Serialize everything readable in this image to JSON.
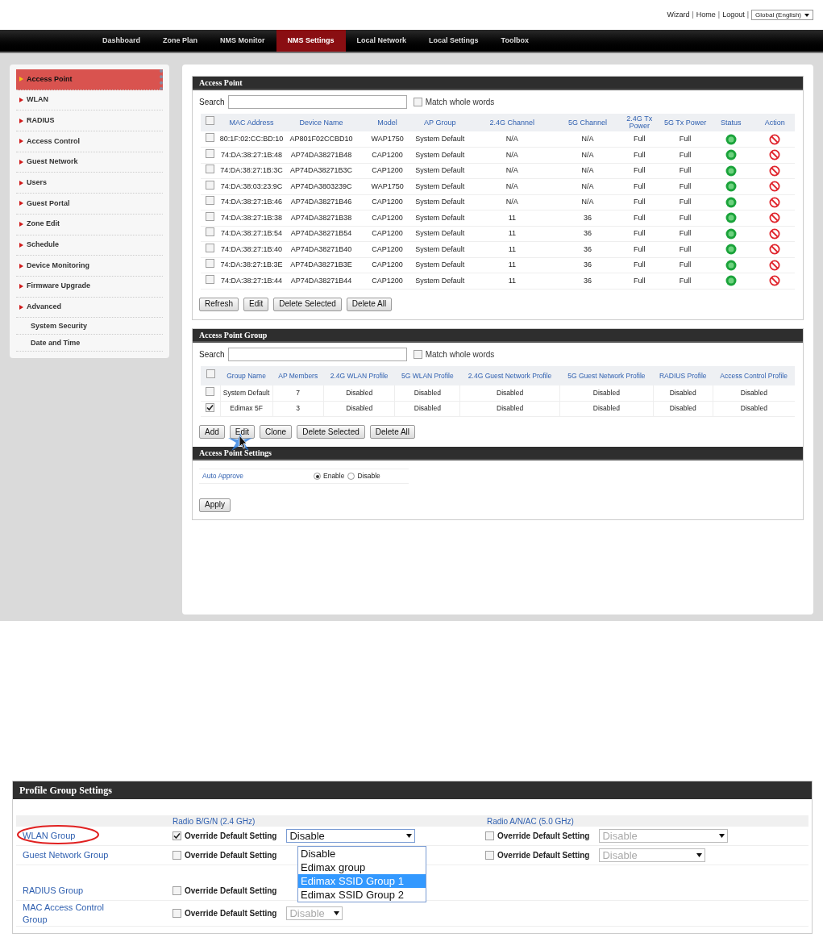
{
  "top_links": [
    "Wizard",
    "Home",
    "Logout"
  ],
  "link_separator": "|",
  "language_select": "Global (English)",
  "nav": [
    {
      "label": "Dashboard",
      "selected": false
    },
    {
      "label": "Zone Plan",
      "selected": false
    },
    {
      "label": "NMS Monitor",
      "selected": false
    },
    {
      "label": "NMS Settings",
      "selected": true
    },
    {
      "label": "Local Network",
      "selected": false
    },
    {
      "label": "Local Settings",
      "selected": false
    },
    {
      "label": "Toolbox",
      "selected": false
    }
  ],
  "sidebar": [
    {
      "label": "Access Point",
      "kind": "item",
      "selected": true
    },
    {
      "label": "WLAN",
      "kind": "item",
      "selected": false
    },
    {
      "label": "RADIUS",
      "kind": "item",
      "selected": false
    },
    {
      "label": "Access Control",
      "kind": "item",
      "selected": false
    },
    {
      "label": "Guest Network",
      "kind": "item",
      "selected": false
    },
    {
      "label": "Users",
      "kind": "item",
      "selected": false
    },
    {
      "label": "Guest Portal",
      "kind": "item",
      "selected": false
    },
    {
      "label": "Zone Edit",
      "kind": "item",
      "selected": false
    },
    {
      "label": "Schedule",
      "kind": "item",
      "selected": false
    },
    {
      "label": "Device Monitoring",
      "kind": "item",
      "selected": false
    },
    {
      "label": "Firmware Upgrade",
      "kind": "item",
      "selected": false
    },
    {
      "label": "Advanced",
      "kind": "item",
      "selected": false
    },
    {
      "label": "System Security",
      "kind": "subitem",
      "selected": false
    },
    {
      "label": "Date and Time",
      "kind": "subitem",
      "selected": false
    }
  ],
  "access_point": {
    "title": "Access Point",
    "search_label": "Search",
    "match_label": "Match whole words",
    "match_checked": false,
    "select_all_checked": false,
    "columns": [
      "MAC Address",
      "Device Name",
      "Model",
      "AP Group",
      "2.4G Channel",
      "5G Channel",
      "2.4G Tx Power",
      "5G Tx Power",
      "Status",
      "Action"
    ],
    "rows": [
      {
        "checked": false,
        "cells": [
          "80:1F:02:CC:BD:10",
          "AP801F02CCBD10",
          "WAP1750",
          "System Default",
          "N/A",
          "N/A",
          "Full",
          "Full"
        ],
        "online": true
      },
      {
        "checked": false,
        "cells": [
          "74:DA:38:27:1B:48",
          "AP74DA38271B48",
          "CAP1200",
          "System Default",
          "N/A",
          "N/A",
          "Full",
          "Full"
        ],
        "online": true
      },
      {
        "checked": false,
        "cells": [
          "74:DA:38:27:1B:3C",
          "AP74DA38271B3C",
          "CAP1200",
          "System Default",
          "N/A",
          "N/A",
          "Full",
          "Full"
        ],
        "online": true
      },
      {
        "checked": false,
        "cells": [
          "74:DA:38:03:23:9C",
          "AP74DA3803239C",
          "WAP1750",
          "System Default",
          "N/A",
          "N/A",
          "Full",
          "Full"
        ],
        "online": true
      },
      {
        "checked": false,
        "cells": [
          "74:DA:38:27:1B:46",
          "AP74DA38271B46",
          "CAP1200",
          "System Default",
          "N/A",
          "N/A",
          "Full",
          "Full"
        ],
        "online": true
      },
      {
        "checked": false,
        "cells": [
          "74:DA:38:27:1B:38",
          "AP74DA38271B38",
          "CAP1200",
          "System Default",
          "11",
          "36",
          "Full",
          "Full"
        ],
        "online": true
      },
      {
        "checked": false,
        "cells": [
          "74:DA:38:27:1B:54",
          "AP74DA38271B54",
          "CAP1200",
          "System Default",
          "11",
          "36",
          "Full",
          "Full"
        ],
        "online": true
      },
      {
        "checked": false,
        "cells": [
          "74:DA:38:27:1B:40",
          "AP74DA38271B40",
          "CAP1200",
          "System Default",
          "11",
          "36",
          "Full",
          "Full"
        ],
        "online": true
      },
      {
        "checked": false,
        "cells": [
          "74:DA:38:27:1B:3E",
          "AP74DA38271B3E",
          "CAP1200",
          "System Default",
          "11",
          "36",
          "Full",
          "Full"
        ],
        "online": true
      },
      {
        "checked": false,
        "cells": [
          "74:DA:38:27:1B:44",
          "AP74DA38271B44",
          "CAP1200",
          "System Default",
          "11",
          "36",
          "Full",
          "Full"
        ],
        "online": true
      }
    ],
    "buttons": [
      "Refresh",
      "Edit",
      "Delete Selected",
      "Delete All"
    ]
  },
  "ap_group": {
    "title": "Access Point Group",
    "search_label": "Search",
    "match_label": "Match whole words",
    "match_checked": false,
    "select_all_checked": false,
    "columns": [
      "Group Name",
      "AP Members",
      "2.4G WLAN Profile",
      "5G WLAN Profile",
      "2.4G Guest Network Profile",
      "5G Guest Network Profile",
      "RADIUS Profile",
      "Access Control Profile"
    ],
    "rows": [
      {
        "checked": false,
        "cells": [
          "System Default",
          "7",
          "Disabled",
          "Disabled",
          "Disabled",
          "Disabled",
          "Disabled",
          "Disabled"
        ]
      },
      {
        "checked": true,
        "cells": [
          "Edimax 5F",
          "3",
          "Disabled",
          "Disabled",
          "Disabled",
          "Disabled",
          "Disabled",
          "Disabled"
        ]
      }
    ],
    "buttons": [
      "Add",
      "Edit",
      "Clone",
      "Delete Selected",
      "Delete All"
    ]
  },
  "ap_settings": {
    "title": "Access Point Settings",
    "label": "Auto Approve",
    "options": [
      {
        "label": "Enable",
        "selected": true
      },
      {
        "label": "Disable",
        "selected": false
      }
    ],
    "button": "Apply"
  },
  "profile_group": {
    "title": "Profile Group Settings",
    "radio_24": "Radio B/G/N (2.4 GHz)",
    "radio_5": "Radio A/N/AC (5.0 GHz)",
    "rows": [
      {
        "label": "WLAN Group",
        "circled": true,
        "radio24": {
          "checked": true,
          "label": "Override Default Setting",
          "value": "Disable",
          "disabled": false
        },
        "radio5": {
          "checked": false,
          "label": "Override Default Setting",
          "value": "Disable",
          "disabled": true
        }
      },
      {
        "label": "Guest Network Group",
        "radio24": {
          "checked": false,
          "label": "Override Default Setting"
        },
        "radio5": {
          "checked": false,
          "label": "Override Default Setting",
          "value": "Disable",
          "disabled": true
        }
      },
      {
        "label": "RADIUS Group",
        "radio24": {
          "checked": false,
          "label": "Override Default Setting"
        }
      },
      {
        "label": "MAC Access Control Group",
        "radio24": {
          "checked": false,
          "label": "Override Default Setting",
          "value": "Disable",
          "disabled": true
        }
      }
    ],
    "dropdown": [
      {
        "label": "Disable",
        "selected": false
      },
      {
        "label": "Edimax group",
        "selected": false
      },
      {
        "label": "Edimax SSID Group 1",
        "selected": true
      },
      {
        "label": "Edimax SSID Group 2",
        "selected": false
      }
    ]
  }
}
